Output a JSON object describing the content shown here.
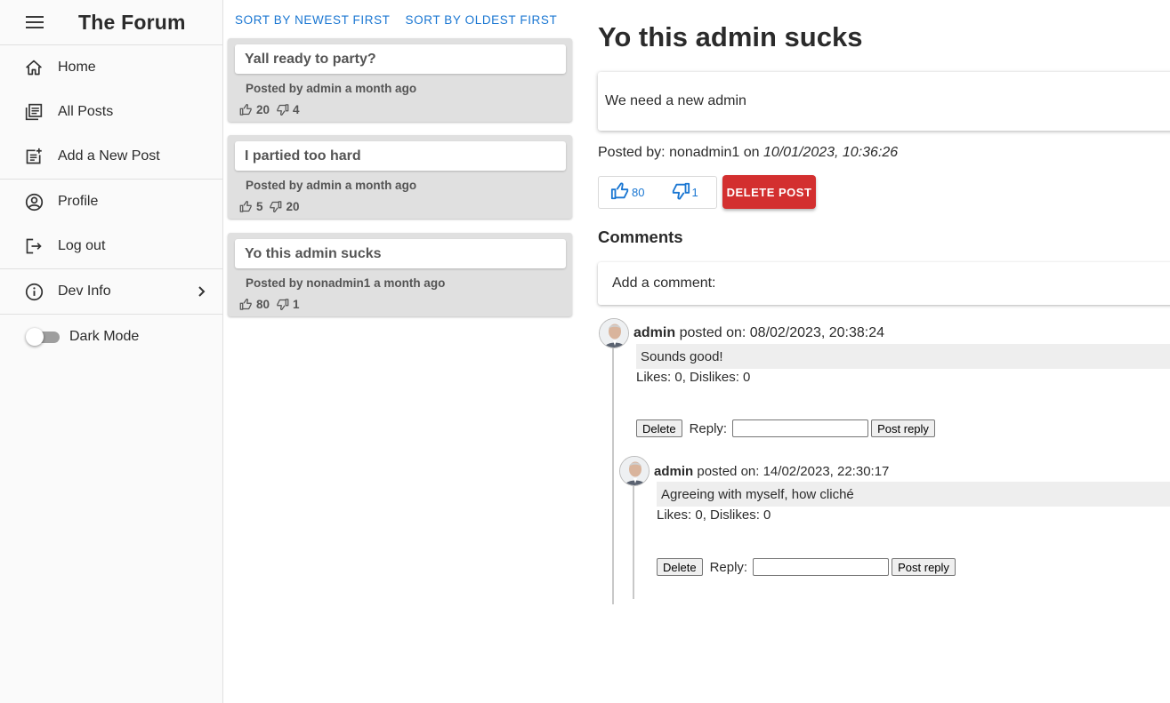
{
  "app": {
    "title": "The Forum"
  },
  "sidebar": {
    "items": [
      {
        "label": "Home",
        "icon": "home-icon"
      },
      {
        "label": "All Posts",
        "icon": "posts-list-icon"
      },
      {
        "label": "Add a New Post",
        "icon": "post-add-icon"
      },
      {
        "label": "Profile",
        "icon": "account-circle-icon"
      },
      {
        "label": "Log out",
        "icon": "logout-icon"
      },
      {
        "label": "Dev Info",
        "icon": "info-icon"
      }
    ],
    "dark_mode_label": "Dark Mode",
    "dark_mode_on": false
  },
  "sort": {
    "newest": "SORT BY NEWEST FIRST",
    "oldest": "SORT BY OLDEST FIRST"
  },
  "posts": [
    {
      "title": "Yall ready to party?",
      "posted_by_label": "Posted by",
      "author": "admin",
      "ago": "a month ago",
      "likes": "20",
      "dislikes": "4"
    },
    {
      "title": "I partied too hard",
      "posted_by_label": "Posted by",
      "author": "admin",
      "ago": "a month ago",
      "likes": "5",
      "dislikes": "20"
    },
    {
      "title": "Yo this admin sucks",
      "posted_by_label": "Posted by",
      "author": "nonadmin1",
      "ago": "a month ago",
      "likes": "80",
      "dislikes": "1"
    }
  ],
  "detail": {
    "title": "Yo this admin sucks",
    "content": "We need a new admin",
    "posted_by_label": "Posted by:",
    "author": "nonadmin1",
    "on_label": "on",
    "date": "10/01/2023, 10:36:26",
    "likes": "80",
    "dislikes": "1",
    "delete_label": "DELETE POST",
    "comments_heading": "Comments",
    "add_comment_label": "Add a comment:"
  },
  "comments": [
    {
      "author": "admin",
      "posted_on_label": "posted on:",
      "date": "08/02/2023, 20:38:24",
      "body": "Sounds good!",
      "stats": "Likes: 0, Dislikes: 0",
      "delete_label": "Delete",
      "reply_label": "Reply:",
      "post_reply_label": "Post reply"
    },
    {
      "author": "admin",
      "posted_on_label": "posted on:",
      "date": "14/02/2023, 22:30:17",
      "body": "Agreeing with myself, how cliché",
      "stats": "Likes: 0, Dislikes: 0",
      "delete_label": "Delete",
      "reply_label": "Reply:",
      "post_reply_label": "Post reply"
    }
  ],
  "colors": {
    "accent": "#1976d2",
    "danger": "#d32f2f",
    "card_bg": "#e0e0e0"
  }
}
